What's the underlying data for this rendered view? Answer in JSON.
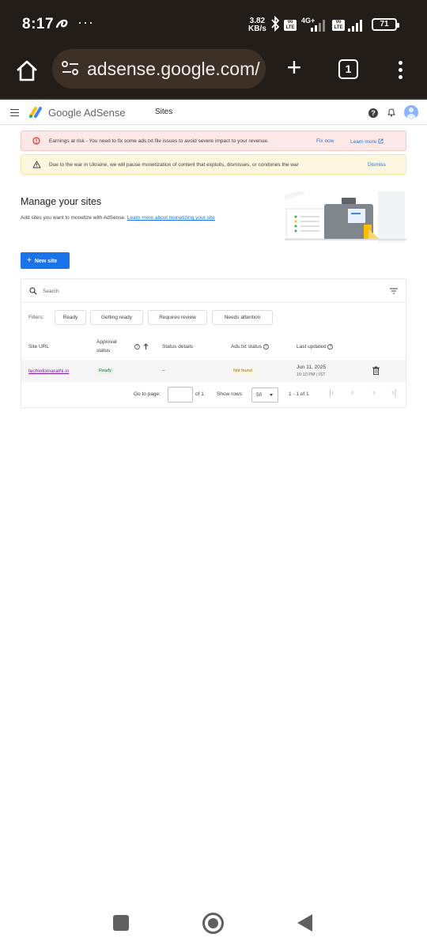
{
  "status_bar": {
    "time": "8:17",
    "dots": "···",
    "speed_value": "3.82",
    "speed_unit": "KB/s",
    "network": "4G+",
    "volte_label": "Vo LTE",
    "battery": "71"
  },
  "browser": {
    "url": "adsense.google.com/",
    "tab_count": "1"
  },
  "header": {
    "brand": "Google AdSense",
    "section": "Sites",
    "help": "?"
  },
  "banners": {
    "error": {
      "text": "Earnings at risk - You need to fix some ads.txt file issues to avoid severe impact to your revenue.",
      "action_label": "Fix now",
      "link_label": "Learn more"
    },
    "warning": {
      "text": "Due to the war in Ukraine, we will pause monetization of content that exploits, dismisses, or condones the war",
      "action_label": "Dismiss"
    }
  },
  "main": {
    "title": "Manage your sites",
    "description": "Add sites you want to monetize with AdSense.",
    "learn_more": "Learn more about monetizing your site",
    "new_site_label": "New site"
  },
  "table": {
    "search_placeholder": "Search",
    "filters_label": "Filters:",
    "filter_chips": [
      "Ready",
      "Getting ready",
      "Requires review",
      "Needs attention"
    ],
    "headers": {
      "site_url": "Site URL",
      "approval_status": "Approval status",
      "status_details": "Status details",
      "ads_txt_status": "Ads.txt status",
      "last_updated": "Last updated"
    },
    "rows": [
      {
        "site_url": "techinfomarathi.in",
        "approval_status": "Ready",
        "status_details": "–",
        "ads_txt_status": "Not found",
        "last_updated_date": "Jun 11, 2025",
        "last_updated_time": "10:10 PM | IST"
      }
    ],
    "pagination": {
      "go_to_page_label": "Go to page:",
      "of_pages": "of 1",
      "show_rows_label": "Show rows:",
      "rows_value": "50",
      "range": "1 - 1 of 1"
    }
  },
  "colors": {
    "chrome_bg": "#221d19",
    "accent": "#1a73e8",
    "error_bg": "#fce8e6",
    "warning_bg": "#fef7e0"
  }
}
